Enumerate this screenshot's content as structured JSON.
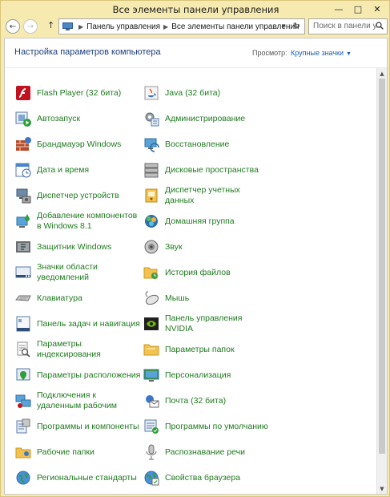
{
  "window": {
    "title": "Все элементы панели управления"
  },
  "navigation": {
    "path": [
      "Панель управления",
      "Все элементы панели управления"
    ],
    "search_placeholder": "Поиск в панели у..."
  },
  "header": {
    "title": "Настройка параметров компьютера",
    "view_by_label": "Просмотр:",
    "view_by_value": "Крупные значки"
  },
  "items": [
    {
      "label": "Flash Player (32 бита)",
      "icon": "flash-player-icon"
    },
    {
      "label": "Java (32 бита)",
      "icon": "java-icon"
    },
    {
      "label": "Автозапуск",
      "icon": "autoplay-icon"
    },
    {
      "label": "Администрирование",
      "icon": "admin-tools-icon"
    },
    {
      "label": "Брандмауэр Windows",
      "icon": "firewall-icon"
    },
    {
      "label": "Восстановление",
      "icon": "recovery-icon"
    },
    {
      "label": "Дата и время",
      "icon": "date-time-icon"
    },
    {
      "label": "Дисковые пространства",
      "icon": "storage-spaces-icon"
    },
    {
      "label": "Диспетчер устройств",
      "icon": "device-manager-icon"
    },
    {
      "label": "Диспетчер учетных данных",
      "icon": "credential-manager-icon"
    },
    {
      "label": "Добавление компонентов в Windows 8.1",
      "icon": "add-features-icon"
    },
    {
      "label": "Домашняя группа",
      "icon": "homegroup-icon"
    },
    {
      "label": "Защитник Windows",
      "icon": "defender-icon"
    },
    {
      "label": "Звук",
      "icon": "sound-icon"
    },
    {
      "label": "Значки области уведомлений",
      "icon": "notification-icons-icon"
    },
    {
      "label": "История файлов",
      "icon": "file-history-icon"
    },
    {
      "label": "Клавиатура",
      "icon": "keyboard-icon"
    },
    {
      "label": "Мышь",
      "icon": "mouse-icon"
    },
    {
      "label": "Панель задач и навигация",
      "icon": "taskbar-icon"
    },
    {
      "label": "Панель управления NVIDIA",
      "icon": "nvidia-icon"
    },
    {
      "label": "Параметры индексирования",
      "icon": "indexing-icon"
    },
    {
      "label": "Параметры папок",
      "icon": "folder-options-icon"
    },
    {
      "label": "Параметры расположения",
      "icon": "location-settings-icon"
    },
    {
      "label": "Персонализация",
      "icon": "personalization-icon"
    },
    {
      "label": "Подключения к удаленным рабочим",
      "icon": "remote-desktop-icon"
    },
    {
      "label": "Почта (32 бита)",
      "icon": "mail-icon"
    },
    {
      "label": "Программы и компоненты",
      "icon": "programs-icon"
    },
    {
      "label": "Программы по умолчанию",
      "icon": "default-programs-icon"
    },
    {
      "label": "Рабочие папки",
      "icon": "work-folders-icon"
    },
    {
      "label": "Распознавание речи",
      "icon": "speech-icon"
    },
    {
      "label": "Региональные стандарты",
      "icon": "region-icon"
    },
    {
      "label": "Свойства браузера",
      "icon": "internet-options-icon"
    }
  ],
  "colors": {
    "link": "#1f7a1f",
    "header": "#1b3d7c",
    "accent": "#1a5fb4",
    "frame": "#f6eab1"
  }
}
